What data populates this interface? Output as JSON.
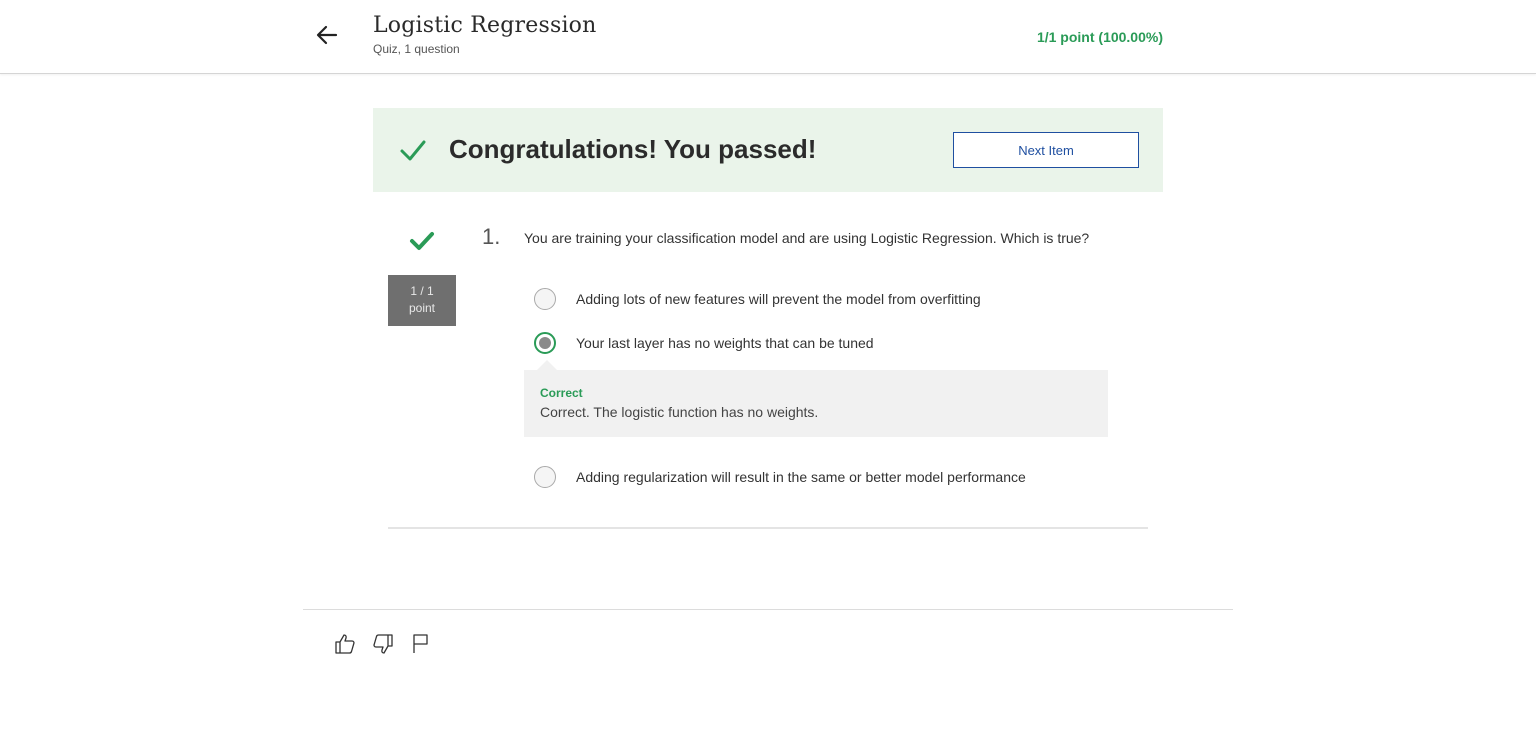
{
  "header": {
    "title": "Logistic Regression",
    "subtitle": "Quiz, 1 question",
    "score": "1/1 point (100.00%)"
  },
  "banner": {
    "message": "Congratulations! You passed!",
    "next_button_label": "Next Item"
  },
  "question": {
    "number": "1.",
    "text": "You are training your classification model and are using Logistic Regression. Which is true?",
    "points_line1": "1 / 1",
    "points_line2": "point",
    "options": [
      {
        "label": "Adding lots of new features will prevent the model from overfitting",
        "selected": false
      },
      {
        "label": "Your last layer has no weights that can be tuned",
        "selected": true
      },
      {
        "label": "Adding regularization will result in the same or better model performance",
        "selected": false
      }
    ],
    "feedback": {
      "title": "Correct",
      "text": "Correct. The logistic function has no weights."
    }
  },
  "footer": {
    "icons": [
      "thumbs-up-icon",
      "thumbs-down-icon",
      "flag-icon"
    ]
  },
  "colors": {
    "accent_green": "#2a9b57",
    "banner_bg": "#eaf4ea",
    "link_blue": "#1f4fa0",
    "badge_gray": "#6f6f6f"
  }
}
